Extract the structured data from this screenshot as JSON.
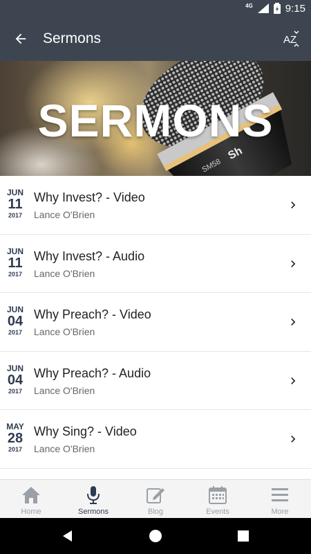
{
  "status_bar": {
    "network": "4G",
    "time": "9:15"
  },
  "app_bar": {
    "title": "Sermons",
    "back_icon": "arrow-left-icon",
    "sort_icon": "sort-az-icon",
    "sort_label": "AZ"
  },
  "hero": {
    "title": "SERMONS",
    "mic_label": "SM58",
    "brand_partial": "Sh"
  },
  "sermons": [
    {
      "month": "JUN",
      "day": "11",
      "year": "2017",
      "title": "Why Invest? - Video",
      "speaker": "Lance O'Brien"
    },
    {
      "month": "JUN",
      "day": "11",
      "year": "2017",
      "title": "Why Invest? - Audio",
      "speaker": "Lance O'Brien"
    },
    {
      "month": "JUN",
      "day": "04",
      "year": "2017",
      "title": "Why Preach? - Video",
      "speaker": "Lance O'Brien"
    },
    {
      "month": "JUN",
      "day": "04",
      "year": "2017",
      "title": "Why Preach? - Audio",
      "speaker": "Lance O'Brien"
    },
    {
      "month": "MAY",
      "day": "28",
      "year": "2017",
      "title": "Why Sing? - Video",
      "speaker": "Lance O'Brien"
    }
  ],
  "tabs": [
    {
      "label": "Home",
      "icon": "home-icon",
      "active": false
    },
    {
      "label": "Sermons",
      "icon": "microphone-icon",
      "active": true
    },
    {
      "label": "Blog",
      "icon": "edit-icon",
      "active": false
    },
    {
      "label": "Events",
      "icon": "calendar-icon",
      "active": false
    },
    {
      "label": "More",
      "icon": "menu-icon",
      "active": false
    }
  ],
  "colors": {
    "app_bar": "#3d4650",
    "date_text": "#2e3c52",
    "tab_inactive": "#9aa0a6",
    "tab_active": "#2e3c52"
  }
}
